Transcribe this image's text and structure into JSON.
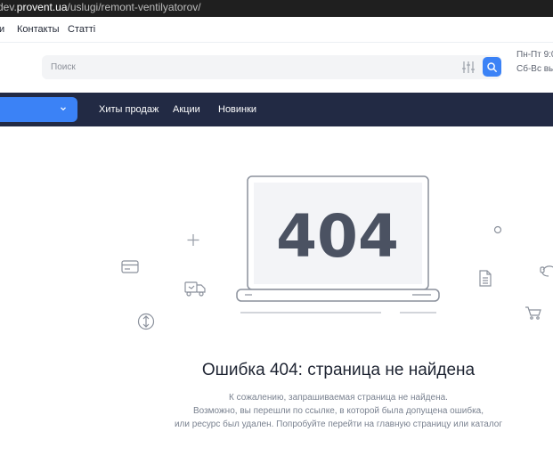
{
  "browser": {
    "url_prefix": "dev.",
    "url_domain": "provent.ua",
    "url_path": "/uslugi/remont-ventilyatorov/"
  },
  "top_links": [
    "и",
    "Контакты",
    "Статті"
  ],
  "search": {
    "placeholder": "Поиск"
  },
  "hours": {
    "line1": "Пн-Пт 9:0",
    "line2": "Сб-Вс вы"
  },
  "menu": [
    "Хиты продаж",
    "Акции",
    "Новинки"
  ],
  "error": {
    "code": "404",
    "title": "Ошибка 404: страница не найдена",
    "desc1": "К сожалению, запрашиваемая страница не найдена.",
    "desc2": "Возможно, вы перешли по ссылке, в которой была допущена ошибка,",
    "desc3": "или ресурс был удален. Попробуйте перейти на главную страницу или каталог"
  },
  "colors": {
    "accent": "#3b82f6",
    "nav_bg": "#222a44",
    "code_text": "#4b5262",
    "icon_stroke": "#8b919c"
  }
}
